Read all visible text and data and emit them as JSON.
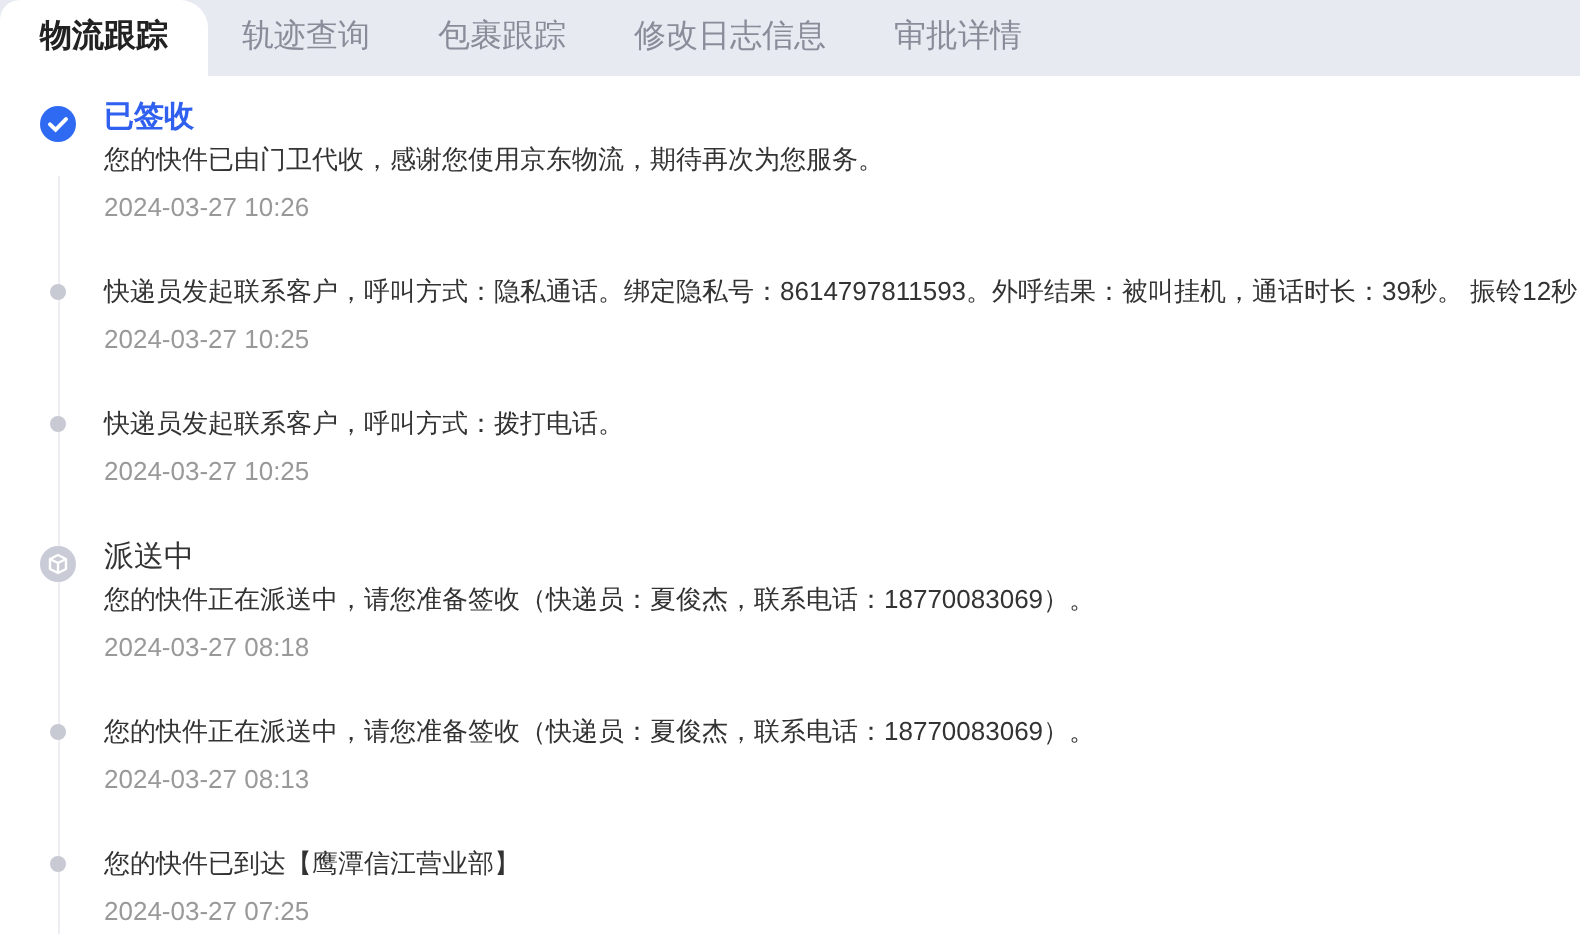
{
  "tabs": [
    {
      "label": "物流跟踪",
      "selected": true
    },
    {
      "label": "轨迹查询",
      "selected": false
    },
    {
      "label": "包裹跟踪",
      "selected": false
    },
    {
      "label": "修改日志信息",
      "selected": false
    },
    {
      "label": "审批详情",
      "selected": false
    }
  ],
  "timeline": [
    {
      "kind": "signed",
      "status": "已签收",
      "text": "您的快件已由门卫代收，感谢您使用京东物流，期待再次为您服务。",
      "time": "2024-03-27 10:26"
    },
    {
      "kind": "dot",
      "text": "快递员发起联系客户，呼叫方式：隐私通话。绑定隐私号：8614797811593。外呼结果：被叫挂机，通话时长：39秒。 振铃12秒",
      "time": "2024-03-27 10:25"
    },
    {
      "kind": "dot",
      "text": "快递员发起联系客户，呼叫方式：拨打电话。",
      "time": "2024-03-27 10:25"
    },
    {
      "kind": "delivering",
      "status": "派送中",
      "text": "您的快件正在派送中，请您准备签收（快递员：夏俊杰，联系电话：18770083069）。",
      "time": "2024-03-27 08:18"
    },
    {
      "kind": "dot",
      "text": "您的快件正在派送中，请您准备签收（快递员：夏俊杰，联系电话：18770083069）。",
      "time": "2024-03-27 08:13"
    },
    {
      "kind": "dot",
      "text": "您的快件已到达【鹰潭信江营业部】",
      "time": "2024-03-27 07:25"
    }
  ]
}
